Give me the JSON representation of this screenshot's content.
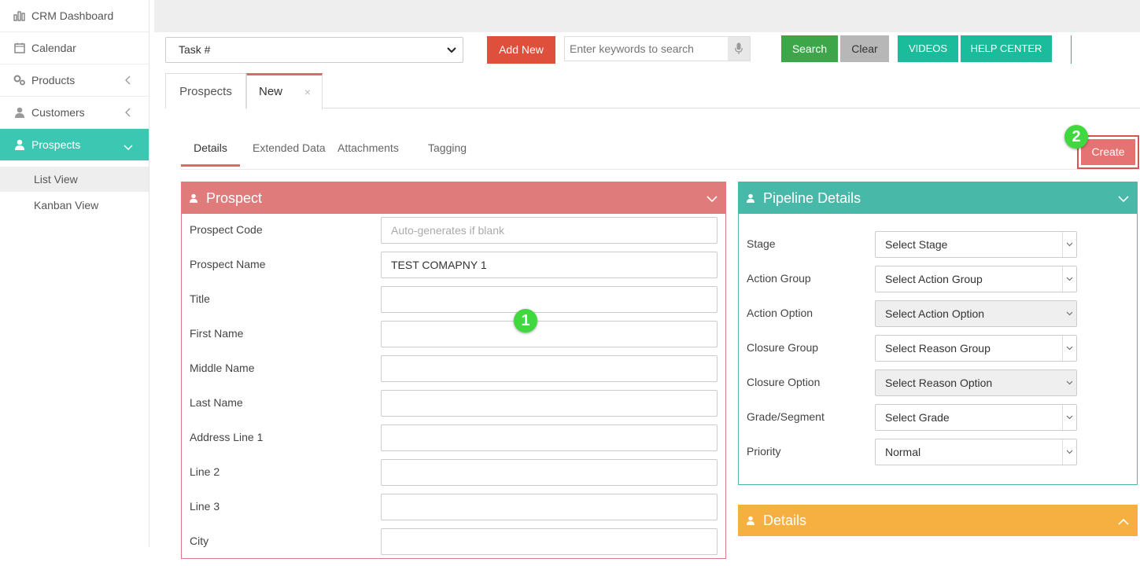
{
  "sidebar": {
    "items": [
      {
        "label": "CRM Dashboard",
        "icon": "bar-chart-icon"
      },
      {
        "label": "Calendar",
        "icon": "calendar-icon"
      },
      {
        "label": "Products",
        "icon": "gears-icon"
      },
      {
        "label": "Customers",
        "icon": "user-icon"
      },
      {
        "label": "Prospects",
        "icon": "user-icon"
      }
    ],
    "subitems": [
      "List View",
      "Kanban View"
    ]
  },
  "toolbar": {
    "task_select": "Task #",
    "add_new": "Add New",
    "search_placeholder": "Enter keywords to search",
    "search": "Search",
    "clear": "Clear",
    "videos": "VIDEOS",
    "help_center": "HELP CENTER"
  },
  "tabs": [
    {
      "label": "Prospects"
    },
    {
      "label": "New",
      "close": "×"
    }
  ],
  "subtabs": [
    "Details",
    "Extended Data",
    "Attachments",
    "Tagging"
  ],
  "create_button": "Create",
  "badges": [
    "1",
    "2"
  ],
  "prospect_panel": {
    "title": "Prospect",
    "fields": [
      {
        "label": "Prospect Code",
        "value": "",
        "placeholder": "Auto-generates if blank"
      },
      {
        "label": "Prospect Name",
        "value": "TEST COMAPNY 1",
        "placeholder": ""
      },
      {
        "label": "Title",
        "value": "",
        "placeholder": ""
      },
      {
        "label": "First Name",
        "value": "",
        "placeholder": ""
      },
      {
        "label": "Middle Name",
        "value": "",
        "placeholder": ""
      },
      {
        "label": "Last Name",
        "value": "",
        "placeholder": ""
      },
      {
        "label": "Address Line 1",
        "value": "",
        "placeholder": ""
      },
      {
        "label": "Line 2",
        "value": "",
        "placeholder": ""
      },
      {
        "label": "Line 3",
        "value": "",
        "placeholder": ""
      },
      {
        "label": "City",
        "value": "",
        "placeholder": ""
      }
    ]
  },
  "pipeline_panel": {
    "title": "Pipeline Details",
    "fields": [
      {
        "label": "Stage",
        "value": "Select Stage"
      },
      {
        "label": "Action Group",
        "value": "Select Action Group"
      },
      {
        "label": "Action Option",
        "value": "Select Action Option"
      },
      {
        "label": "Closure Group",
        "value": "Select Reason Group"
      },
      {
        "label": "Closure Option",
        "value": "Select Reason Option"
      },
      {
        "label": "Grade/Segment",
        "value": "Select Grade"
      },
      {
        "label": "Priority",
        "value": "Normal"
      }
    ]
  },
  "details_panel": {
    "title": "Details"
  },
  "colors": {
    "teal": "#3cc7b3",
    "prospect_red": "#e07b7b",
    "pipeline_teal": "#48b8a8",
    "details_orange": "#f6b041",
    "add_new_red": "#de4f3c",
    "search_green": "#3ca649"
  }
}
